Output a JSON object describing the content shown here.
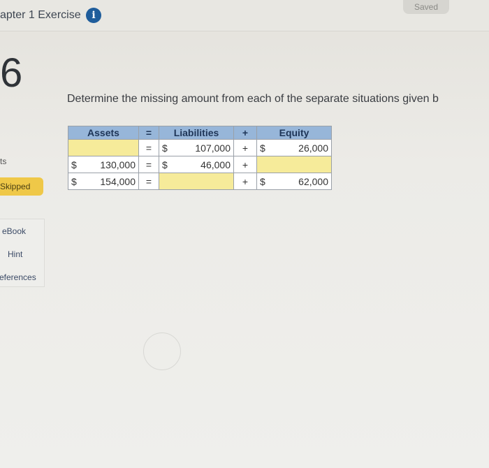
{
  "header": {
    "chapter_title": "apter 1 Exercise",
    "info_icon": "i",
    "saved_label": "Saved"
  },
  "question_number": "6",
  "sidebar": {
    "points_label": "ts",
    "status_label": "Skipped",
    "links": [
      "eBook",
      "Hint",
      "eferences"
    ]
  },
  "question_text": "Determine the missing amount from each of the separate situations given b",
  "table": {
    "headers": {
      "assets": "Assets",
      "eq_sign": "=",
      "liabilities": "Liabilities",
      "plus_sign": "+",
      "equity": "Equity"
    },
    "rows": [
      {
        "assets_sym": "",
        "assets": "",
        "eq": "=",
        "liab_sym": "$",
        "liabilities": "107,000",
        "plus": "+",
        "equity_sym": "$",
        "equity": "26,000"
      },
      {
        "assets_sym": "$",
        "assets": "130,000",
        "eq": "=",
        "liab_sym": "$",
        "liabilities": "46,000",
        "plus": "+",
        "equity_sym": "",
        "equity": ""
      },
      {
        "assets_sym": "$",
        "assets": "154,000",
        "eq": "=",
        "liab_sym": "",
        "liabilities": "",
        "plus": "+",
        "equity_sym": "$",
        "equity": "62,000"
      }
    ]
  },
  "colors": {
    "header_blue": "#97b6d9",
    "input_yellow": "#f6eb9a",
    "skipped_badge": "#efc848",
    "info_blue": "#1f5d9b"
  }
}
